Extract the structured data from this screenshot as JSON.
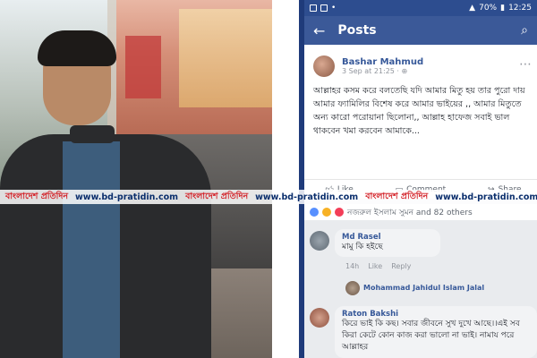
{
  "status_bar": {
    "battery": "70%",
    "time": "12:25"
  },
  "app_bar": {
    "title": "Posts"
  },
  "post": {
    "author": "Bashar Mahmud",
    "time": "3 Sep at 21:25 · ",
    "text": "আল্লাহর কসম করে বলতেছি যদি আমার মিতু হয় তার পুরো দায় আমার ফ্যামিলির বিশেষ করে আমার ভাইয়ের ,, আমার মিতুতে অন্য কারো পরোয়ানা ছিলোনা,, আল্লাহ হাফেজ সবাই ভাল থাকবেন খমা করবেন আমাকে...",
    "actions": [
      "Like",
      "Comment",
      "Share"
    ]
  },
  "reactions": {
    "text": "নজরুল ইসলাম সুমন and 82 others"
  },
  "comments": [
    {
      "name": "Md Rasel",
      "text": "মামু কি হইছে",
      "meta_time": "14h",
      "meta_like": "Like",
      "meta_reply": "Reply"
    },
    {
      "name": "Mohammad Jahidul Islam Jalal"
    },
    {
      "name": "Raton Bakshi",
      "text": "কিরে ভাই কি কছ। সবার জীবনে সুখ দুখে আছে।।এই সব কিরা কেটে কোন কাজ করা ভালো না ভাই। নামায পরে আল্লাহর"
    }
  ],
  "watermark": {
    "brand": "বাংলাদেশ প্রতিদিন",
    "url": "www.bd-pratidin.com"
  },
  "colors": {
    "fb_blue": "#3b5998",
    "link_blue": "#365899",
    "wm_red": "#d32027",
    "wm_blue": "#0b2f6d"
  }
}
